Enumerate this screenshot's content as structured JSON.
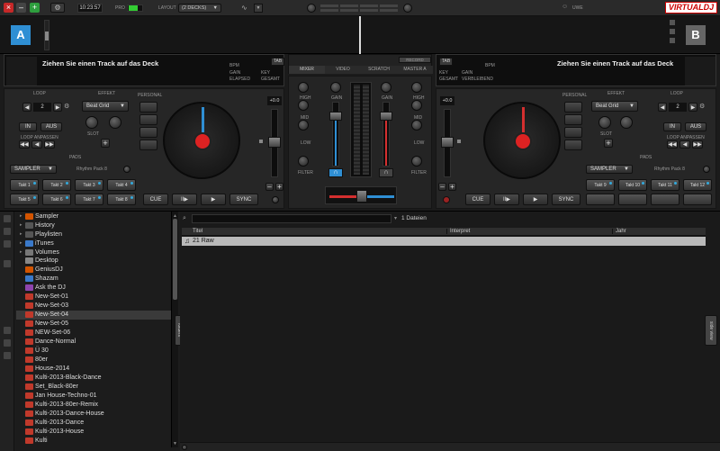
{
  "topbar": {
    "time": "10:23:57",
    "pro_label": "PRO",
    "layout_label": "LAYOUT",
    "layout_value": "(2 DECKS)",
    "user_label": "UWE",
    "brand": "VIRTUALDJ",
    "close_label": "×",
    "minimize_label": "–",
    "maximize_label": "+"
  },
  "decks": {
    "left_letter": "A",
    "right_letter": "B",
    "left_prompt": "Ziehen Sie einen Track auf das Deck",
    "right_prompt": "Ziehen Sie einen Track auf das Deck",
    "tab_label": "TAB",
    "bpm_label": "BPM",
    "gain_label": "GAIN",
    "key_label": "KEY",
    "elapsed_label": "ELAPSED",
    "total_label": "GESAMT",
    "remain_label": "VERBLEIBEND"
  },
  "left_deck": {
    "loop_label": "LOOP",
    "effekt_label": "EFFEKT",
    "loop_value": "2",
    "effect_value": "Beat Grid",
    "in_label": "IN",
    "out_label": "AUS",
    "slot_label": "SLOT",
    "loop_move_label": "LOOP ANPASSEN",
    "pads_label": "PADS",
    "sampler_label": "SAMPLER",
    "rhythm_label": "Rhythm Pack 8",
    "pads": [
      "Takt 1",
      "Takt 2",
      "Takt 3",
      "Takt 4",
      "Takt 5",
      "Takt 6",
      "Takt 7",
      "Takt 8"
    ],
    "personal_label": "PERSONAL",
    "pitch_value": "+0.0",
    "cue_label": "CUE",
    "play_label": "▶",
    "pause_label": "II▶",
    "sync_label": "SYNC"
  },
  "right_deck": {
    "loop_label": "LOOP",
    "effekt_label": "EFFEKT",
    "loop_value": "2",
    "effect_value": "Beat Grid",
    "in_label": "IN",
    "out_label": "AUS",
    "slot_label": "SLOT",
    "loop_move_label": "LOOP ANPASSEN",
    "pads_label": "PADS",
    "sampler_label": "SAMPLER",
    "rhythm_label": "Rhythm Pack 8",
    "pads": [
      "Takt 9",
      "Takt 10",
      "Takt 11",
      "Takt 12"
    ],
    "personal_label": "PERSONAL",
    "pitch_value": "+0.0",
    "cue_label": "CUE",
    "play_label": "▶",
    "pause_label": "II▶",
    "sync_label": "SYNC"
  },
  "mixer": {
    "tabs": [
      "MIXER",
      "VIDEO",
      "SCRATCH",
      "MASTER A"
    ],
    "high_label": "HIGH",
    "mid_label": "MID",
    "low_label": "LOW",
    "filter_label": "FILTER",
    "gain_label": "GAIN",
    "record_label": "RECORD"
  },
  "browser": {
    "file_count": "1 Dateien",
    "search_placeholder": "",
    "columns": [
      "Titel",
      "Interpret",
      "Jahr"
    ],
    "rows": [
      {
        "title": "21 Raw",
        "artist": "",
        "year": ""
      }
    ],
    "folders_tab": "folders",
    "sideview_tab": "side view",
    "tree": [
      {
        "label": "Sampler",
        "color": "#d35400",
        "expand": true
      },
      {
        "label": "History",
        "color": "#555555",
        "expand": true
      },
      {
        "label": "Playlisten",
        "color": "#555555",
        "expand": true
      },
      {
        "label": "iTunes",
        "color": "#3a79c9",
        "expand": true
      },
      {
        "label": "Volumes",
        "color": "#777777",
        "expand": true
      },
      {
        "label": "Desktop",
        "color": "#888888",
        "expand": false
      },
      {
        "label": "GeniusDJ",
        "color": "#d35400",
        "expand": false
      },
      {
        "label": "Shazam",
        "color": "#3a79c9",
        "expand": false
      },
      {
        "label": "Ask the DJ",
        "color": "#8e44ad",
        "expand": false
      },
      {
        "label": "New-Set-01",
        "color": "#c0392b",
        "expand": false
      },
      {
        "label": "New-Set-03",
        "color": "#c0392b",
        "expand": false
      },
      {
        "label": "New-Set-04",
        "color": "#c0392b",
        "expand": false,
        "selected": true
      },
      {
        "label": "New-Set-05",
        "color": "#c0392b",
        "expand": false
      },
      {
        "label": "NEW-Set-06",
        "color": "#c0392b",
        "expand": false
      },
      {
        "label": "Dance-Normal",
        "color": "#c0392b",
        "expand": false
      },
      {
        "label": "Ü 30",
        "color": "#c0392b",
        "expand": false
      },
      {
        "label": "80er",
        "color": "#c0392b",
        "expand": false
      },
      {
        "label": "House-2014",
        "color": "#c0392b",
        "expand": false
      },
      {
        "label": "Kulti-2013-Black-Dance",
        "color": "#c0392b",
        "expand": false
      },
      {
        "label": "Set_Black-80er",
        "color": "#c0392b",
        "expand": false
      },
      {
        "label": "Jan House-Techno-01",
        "color": "#c0392b",
        "expand": false
      },
      {
        "label": "Kulti-2013-80er-Remix",
        "color": "#c0392b",
        "expand": false
      },
      {
        "label": "Kulti-2013-Dance-House",
        "color": "#c0392b",
        "expand": false
      },
      {
        "label": "Kulti-2013-Dance",
        "color": "#c0392b",
        "expand": false
      },
      {
        "label": "Kulti-2013-House",
        "color": "#c0392b",
        "expand": false
      },
      {
        "label": "Kulti",
        "color": "#c0392b",
        "expand": false
      }
    ]
  },
  "colors": {
    "deck_a": "#2f8fd4",
    "deck_b": "#d42f2f",
    "brand_red": "#cc0000"
  }
}
